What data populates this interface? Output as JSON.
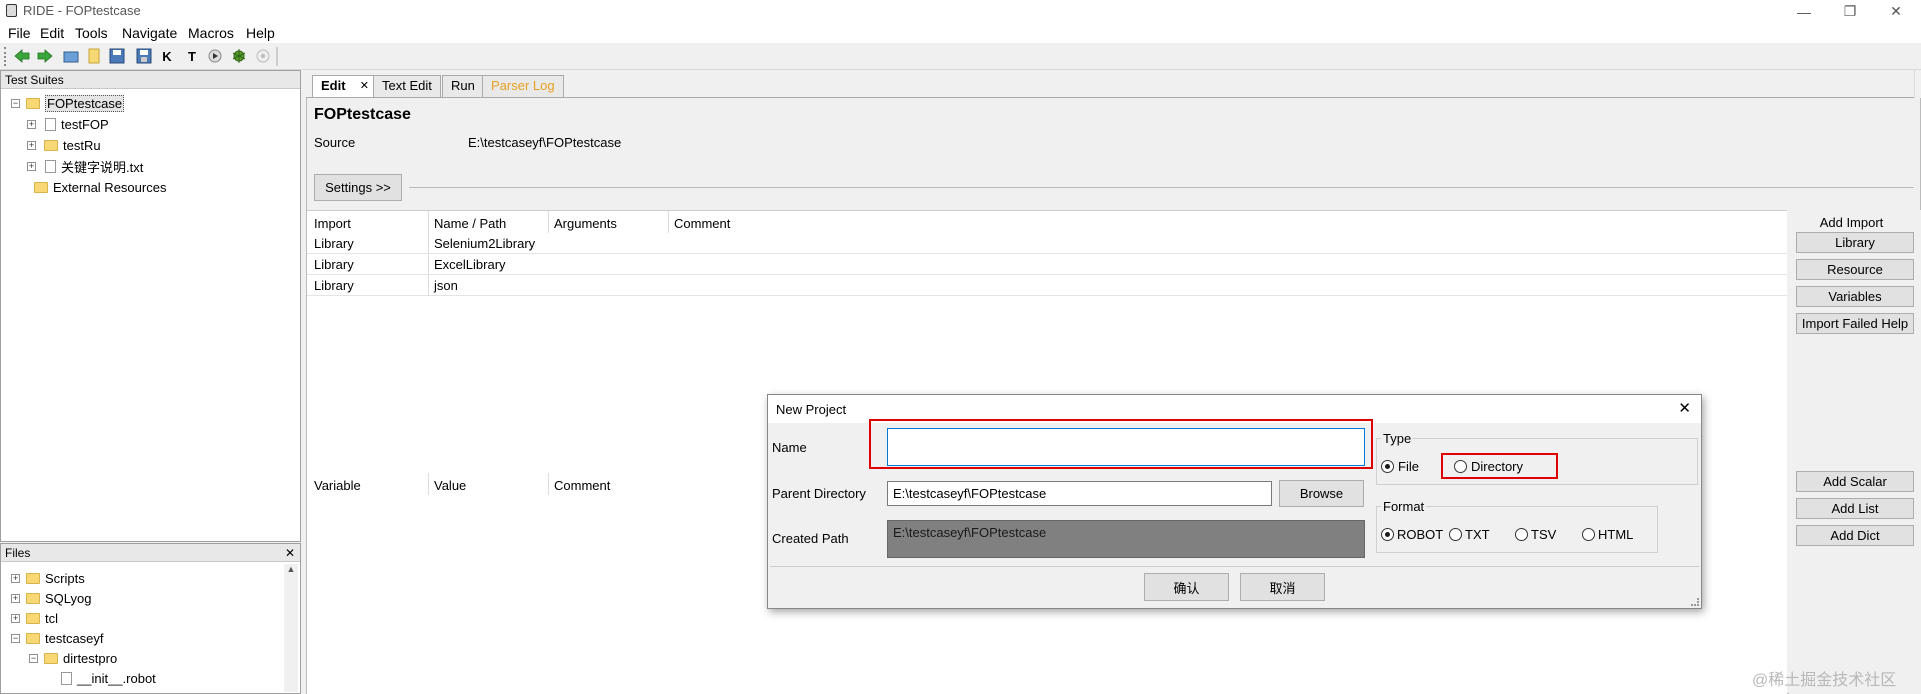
{
  "window": {
    "title": "RIDE - FOPtestcase",
    "minimize_glyph": "—",
    "restore_glyph": "❐",
    "close_glyph": "✕"
  },
  "menu": [
    "File",
    "Edit",
    "Tools",
    "Navigate",
    "Macros",
    "Help"
  ],
  "toolbar": {
    "icons": [
      "arrow-left-icon",
      "arrow-right-icon",
      "open-folder-icon",
      "new-file-icon",
      "save-icon",
      "save-all-icon",
      "keyword-search-icon",
      "test-search-icon",
      "run-icon",
      "bug-icon",
      "stop-icon"
    ],
    "k_glyph": "K",
    "t_glyph": "T"
  },
  "tree": {
    "header": "Test Suites",
    "root": "FOPtestcase",
    "children": [
      {
        "label": "testFOP",
        "icon": "file-icon"
      },
      {
        "label": "testRu",
        "icon": "folder-icon"
      },
      {
        "label": "关键字说明.txt",
        "icon": "file-icon"
      }
    ],
    "external": "External Resources",
    "expand_glyph": "+",
    "collapse_glyph": "−"
  },
  "files": {
    "header": "Files",
    "close_glyph": "✕",
    "items": [
      "Scripts",
      "SQLyog",
      "tcl",
      "testcaseyf",
      "dirtestpro",
      "__init__.robot"
    ]
  },
  "tabs": [
    "Edit",
    "Text Edit",
    "Run",
    "Parser Log"
  ],
  "tab_close_glyph": "✕",
  "editor": {
    "suite_name": "FOPtestcase",
    "source_label": "Source",
    "source_value": "E:\\testcaseyf\\FOPtestcase",
    "settings_button": "Settings >>",
    "import_headers": [
      "Import",
      "Name / Path",
      "Arguments",
      "Comment"
    ],
    "imports": [
      {
        "type": "Library",
        "name": "Selenium2Library"
      },
      {
        "type": "Library",
        "name": "ExcelLibrary"
      },
      {
        "type": "Library",
        "name": "json"
      }
    ],
    "variable_headers": [
      "Variable",
      "Value",
      "Comment"
    ]
  },
  "right_panel": {
    "add_import_label": "Add Import",
    "import_buttons": [
      "Library",
      "Resource",
      "Variables",
      "Import Failed Help"
    ],
    "variable_buttons": [
      "Add Scalar",
      "Add List",
      "Add Dict"
    ]
  },
  "dialog": {
    "title": "New Project",
    "close_glyph": "✕",
    "name_label": "Name",
    "name_value": "",
    "parent_label": "Parent Directory",
    "parent_value": "E:\\testcaseyf\\FOPtestcase",
    "browse_button": "Browse",
    "created_label": "Created Path",
    "created_value": "E:\\testcaseyf\\FOPtestcase",
    "type_label": "Type",
    "type_options": [
      "File",
      "Directory"
    ],
    "type_selected": "File",
    "format_label": "Format",
    "format_options": [
      "ROBOT",
      "TXT",
      "TSV",
      "HTML"
    ],
    "format_selected": "ROBOT",
    "ok_button": "确认",
    "cancel_button": "取消"
  },
  "watermark": "@稀土掘金技术社区",
  "colors": {
    "highlight": "#e00000",
    "parser_log": "#e8a020",
    "created_path_bg": "#808080"
  }
}
